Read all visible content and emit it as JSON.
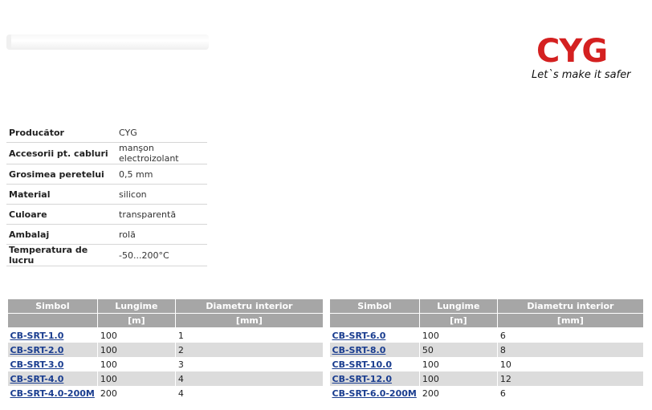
{
  "logo": {
    "wordmark": "CYG",
    "tagline": "Let`s make it safer",
    "color": "#d42020"
  },
  "properties": [
    {
      "key": "Producător",
      "value": "CYG"
    },
    {
      "key": "Accesorii pt. cabluri",
      "value": "manşon electroizolant"
    },
    {
      "key": "Grosimea peretelui",
      "value": "0,5 mm"
    },
    {
      "key": "Material",
      "value": "silicon"
    },
    {
      "key": "Culoare",
      "value": "transparentă"
    },
    {
      "key": "Ambalaj",
      "value": "rolă"
    },
    {
      "key": "Temperatura de lucru",
      "value": "-50...200°C"
    }
  ],
  "product_table": {
    "headers": {
      "symbol": "Simbol",
      "length": "Lungime",
      "diameter": "Diametru interior"
    },
    "units": {
      "length": "[m]",
      "diameter": "[mm]"
    },
    "left_rows": [
      {
        "symbol": "CB-SRT-1.0",
        "length": "100",
        "diameter": "1"
      },
      {
        "symbol": "CB-SRT-2.0",
        "length": "100",
        "diameter": "2"
      },
      {
        "symbol": "CB-SRT-3.0",
        "length": "100",
        "diameter": "3"
      },
      {
        "symbol": "CB-SRT-4.0",
        "length": "100",
        "diameter": "4"
      },
      {
        "symbol": "CB-SRT-4.0-200M",
        "length": "200",
        "diameter": "4"
      }
    ],
    "right_rows": [
      {
        "symbol": "CB-SRT-6.0",
        "length": "100",
        "diameter": "6"
      },
      {
        "symbol": "CB-SRT-8.0",
        "length": "50",
        "diameter": "8"
      },
      {
        "symbol": "CB-SRT-10.0",
        "length": "100",
        "diameter": "10"
      },
      {
        "symbol": "CB-SRT-12.0",
        "length": "100",
        "diameter": "12"
      },
      {
        "symbol": "CB-SRT-6.0-200M",
        "length": "200",
        "diameter": "6"
      }
    ]
  }
}
